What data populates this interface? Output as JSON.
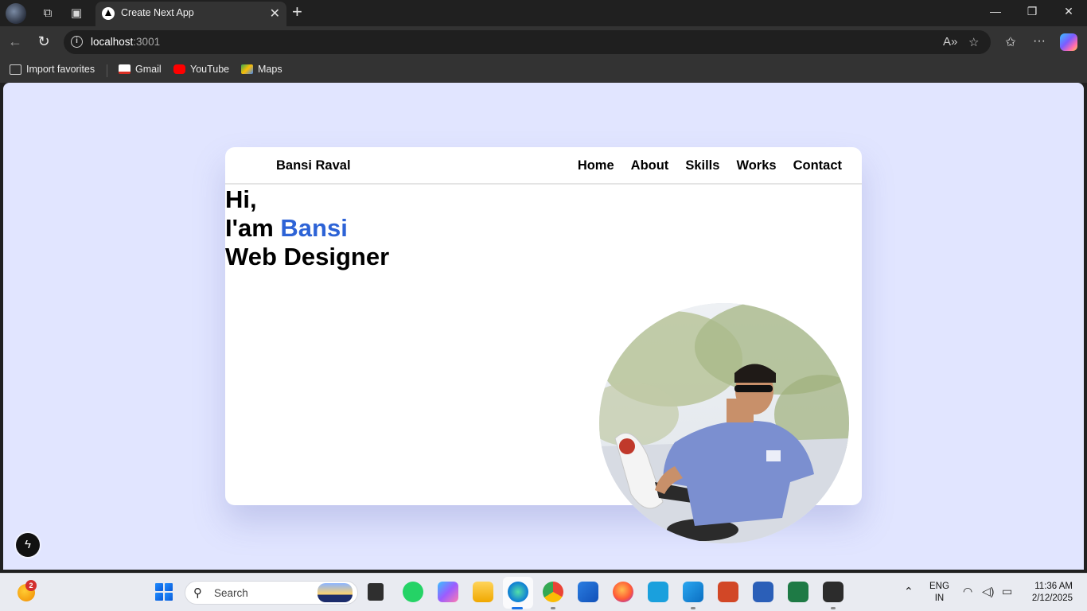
{
  "browser": {
    "tab_title": "Create Next App",
    "tab_close": "✕",
    "new_tab": "+",
    "url_host": "localhost",
    "url_port": ":3001",
    "window": {
      "minimize": "—",
      "restore": "❐",
      "close": "✕"
    },
    "favorites": [
      {
        "label": "Import favorites"
      },
      {
        "label": "Gmail"
      },
      {
        "label": "YouTube"
      },
      {
        "label": "Maps"
      }
    ]
  },
  "site": {
    "brand": "Bansi Raval",
    "nav": [
      "Home",
      "About",
      "Skills",
      "Works",
      "Contact"
    ],
    "hero": {
      "line1": "Hi,",
      "line2_prefix": "I'am ",
      "line2_name": "Bansi",
      "line3": "Web Designer"
    },
    "accent_color": "#2d63d6"
  },
  "taskbar": {
    "notification_count": "2",
    "search_label": "Search",
    "lang_line1": "ENG",
    "lang_line2": "IN",
    "time": "11:36 AM",
    "date": "2/12/2025"
  }
}
